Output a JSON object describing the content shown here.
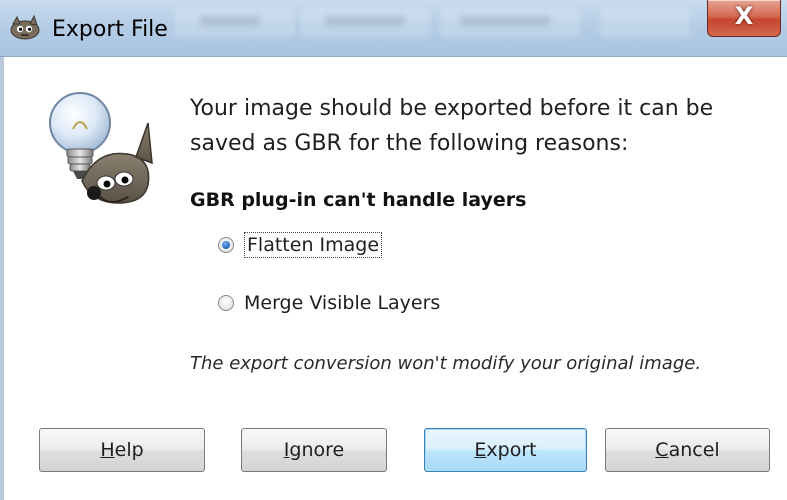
{
  "window": {
    "title": "Export File",
    "close_glyph": "X"
  },
  "dialog": {
    "message": "Your image should be exported before it can be saved as GBR for the following reasons:",
    "reason": "GBR plug-in can't handle layers",
    "options": [
      {
        "label": "Flatten Image",
        "checked": true
      },
      {
        "label": "Merge Visible Layers",
        "checked": false
      }
    ],
    "note": "The export conversion won't modify your original image.",
    "icon": "gimp-lightbulb-icon"
  },
  "buttons": {
    "help": {
      "mnemonic": "H",
      "rest": "elp"
    },
    "ignore": {
      "mnemonic": "I",
      "rest": "gnore"
    },
    "export": {
      "mnemonic": "E",
      "rest": "xport"
    },
    "cancel": {
      "mnemonic": "C",
      "rest": "ancel"
    }
  },
  "colors": {
    "titlebar": "#b5cde6",
    "close_button": "#c4462d",
    "default_button_border": "#3c7fb1",
    "radio_selected": "#2c6bc4"
  }
}
